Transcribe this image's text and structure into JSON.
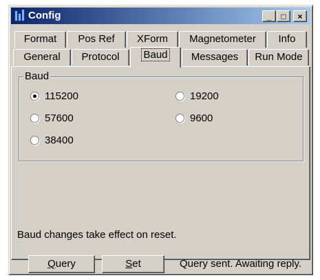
{
  "window": {
    "title": "Config",
    "minimize_label": "_",
    "maximize_label": "□",
    "close_label": "×"
  },
  "tabs_row1": [
    {
      "label": "Format"
    },
    {
      "label": "Pos Ref"
    },
    {
      "label": "XForm"
    },
    {
      "label": "Magnetometer"
    },
    {
      "label": "Info"
    }
  ],
  "tabs_row2": [
    {
      "label": "General"
    },
    {
      "label": "Protocol"
    },
    {
      "label": "Baud",
      "active": true
    },
    {
      "label": "Messages"
    },
    {
      "label": "Run Mode"
    }
  ],
  "baud_group": {
    "legend": "Baud",
    "options": [
      {
        "label": "115200",
        "checked": true
      },
      {
        "label": "19200",
        "checked": false
      },
      {
        "label": "57600",
        "checked": false
      },
      {
        "label": "9600",
        "checked": false
      },
      {
        "label": "38400",
        "checked": false
      }
    ]
  },
  "note": "Baud changes take effect on reset.",
  "buttons": {
    "query_access": "Q",
    "query_rest": "uery",
    "set_access": "S",
    "set_rest": "et"
  },
  "status": "Query sent. Awaiting reply."
}
